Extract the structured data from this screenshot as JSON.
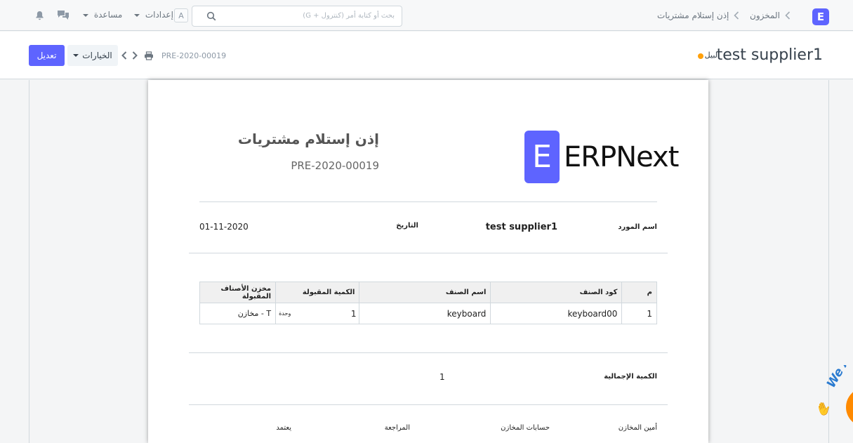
{
  "navbar": {
    "breadcrumb_module": "المخزون",
    "breadcrumb_doctype": "إذن إستلام مشتريات",
    "search_placeholder": "بحث أو كتابة أمر (كنترول + G)",
    "avatar_letter": "A",
    "settings_label": "إعدادات",
    "help_label": "مساعدة",
    "logo_letter": "E"
  },
  "page_head": {
    "title": "test supplier1",
    "status": "لبيل",
    "doc_name": "PRE-2020-00019",
    "options_label": "الخيارات",
    "edit_label": "تعديل"
  },
  "print": {
    "logo_letter": "E",
    "logo_text": "ERPNext",
    "heading": "إذن إستلام مشتريات",
    "doc_number": "PRE-2020-00019",
    "supplier_label": "اسم المورد",
    "supplier_value": "test supplier1",
    "date_label": "التاريخ",
    "date_value": "01-11-2020",
    "table": {
      "headers": [
        "م",
        "كود الصنف",
        "اسم الصنف",
        "الكمية المقبولة",
        "مخزن الأصناف المقبولة"
      ],
      "rows": [
        {
          "idx": "1",
          "item_code": "keyboard00",
          "item_name": "keyboard",
          "qty": "1",
          "uom": "وحدة",
          "warehouse": "مخازن - T"
        }
      ]
    },
    "total_qty_label": "الكمية الإجمالية",
    "total_qty_value": "1",
    "signatures": [
      "أمين المخازن",
      "حسابات المخازن",
      "المراجعة",
      "يعتمد"
    ]
  },
  "badge": {
    "text": "We Are"
  },
  "colors": {
    "primary": "#5e64ff",
    "indicator_orange": "#ffa00a",
    "badge_orange": "#ff8a00",
    "badge_text": "#2b7bd0"
  }
}
